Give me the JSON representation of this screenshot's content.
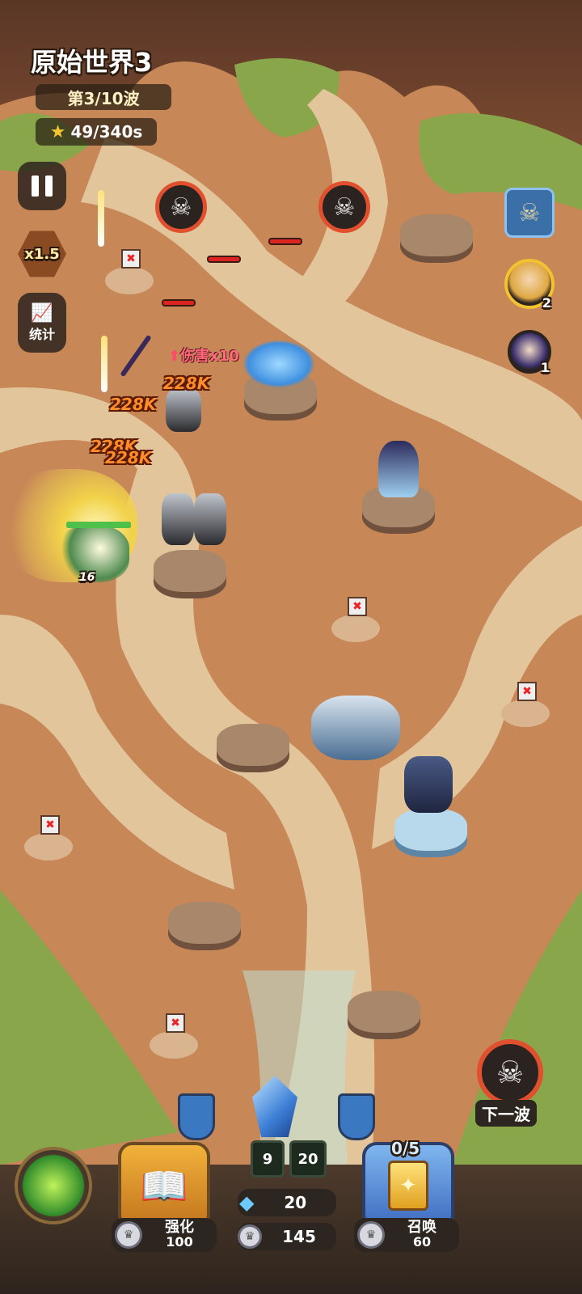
{
  "level": {
    "title": "原始世界3",
    "wave_label": "第3/10波",
    "stars_label": "49/340s"
  },
  "controls": {
    "pause_icon": "pause-icon",
    "speed_label": "x1.5",
    "stats_label": "统计"
  },
  "combat": {
    "buff_label": "伤害x10",
    "damage_popups": [
      "228K",
      "228K",
      "228K",
      "228K"
    ],
    "hero_level": "16"
  },
  "heroes": [
    {
      "name": "dragon-skull-hero",
      "count": ""
    },
    {
      "name": "elf-hero",
      "count": "2"
    },
    {
      "name": "mage-hero",
      "count": "1"
    }
  ],
  "next_wave": {
    "label": "下一波"
  },
  "bottom": {
    "crystal_left": "9",
    "crystal_right": "20",
    "gem_amount": "20",
    "coin_amount": "145",
    "upgrade_label": "强化",
    "upgrade_cost": "100",
    "summon_label": "召唤",
    "summon_cost": "60",
    "summon_progress": "0/5"
  },
  "colors": {
    "path": "#e3c59c",
    "ground": "#c98a5a",
    "grass": "#8aa64a",
    "accent_red": "#e0502e"
  }
}
